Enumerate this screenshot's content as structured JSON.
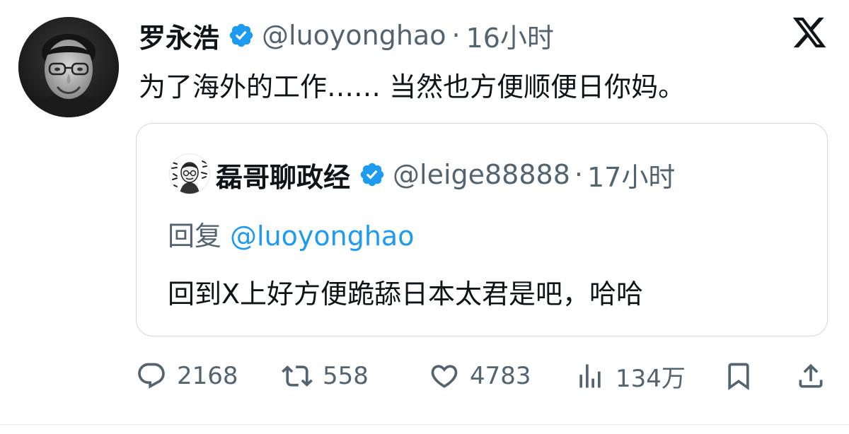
{
  "tweet": {
    "author": {
      "display_name": "罗永浩",
      "handle": "@luoyonghao",
      "verified": true,
      "avatar": "portrait-photo-icon"
    },
    "separator": "·",
    "time": "16小时",
    "text": "为了海外的工作…… 当然也方便顺便日你妈。"
  },
  "quoted_tweet": {
    "author": {
      "display_name": "磊哥聊政经",
      "handle": "@leige88888",
      "verified": true,
      "avatar": "cartoon-avatar-icon"
    },
    "separator": "·",
    "time": "17小时",
    "reply_prefix": "回复",
    "reply_to": "@luoyonghao",
    "text": "回到X上好方便跪舔日本太君是吧，哈哈"
  },
  "actions": {
    "reply_count": "2168",
    "retweet_count": "558",
    "like_count": "4783",
    "views_count": "134万"
  },
  "colors": {
    "text_primary": "#0f1419",
    "text_secondary": "#536471",
    "accent_blue": "#1d9bf0",
    "border": "#cfd9de"
  },
  "icons": {
    "platform": "x-logo-icon",
    "verified": "verified-badge-icon",
    "reply": "reply-icon",
    "retweet": "retweet-icon",
    "like": "heart-icon",
    "views": "views-chart-icon",
    "bookmark": "bookmark-icon",
    "share": "share-icon"
  }
}
